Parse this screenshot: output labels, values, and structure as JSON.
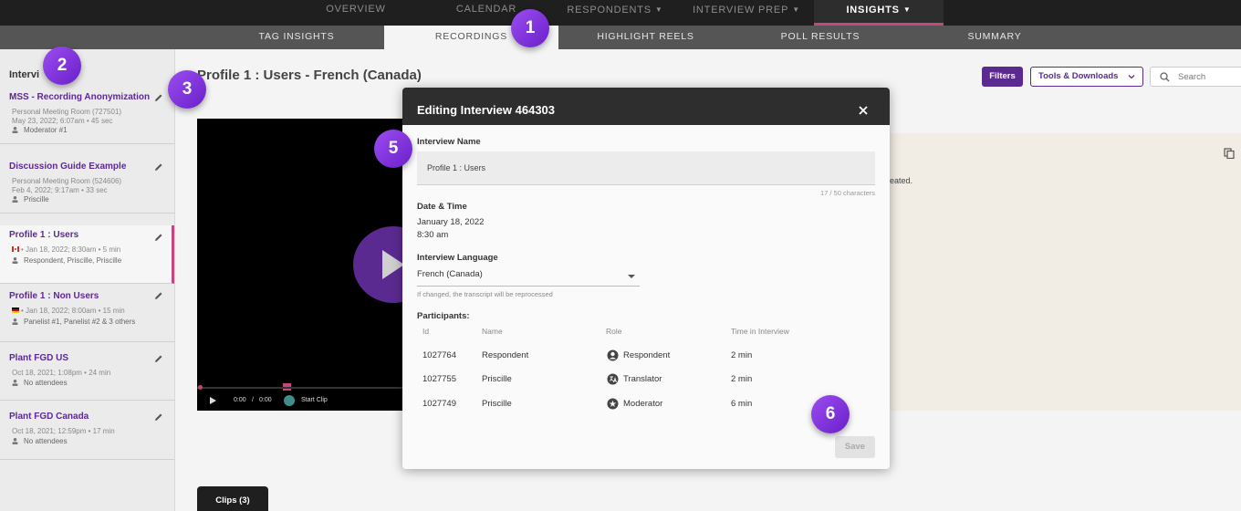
{
  "topnav": [
    {
      "label": "OVERVIEW",
      "dropdown": false
    },
    {
      "label": "CALENDAR",
      "dropdown": false
    },
    {
      "label": "RESPONDENTS",
      "dropdown": true
    },
    {
      "label": "INTERVIEW PREP",
      "dropdown": true
    },
    {
      "label": "INSIGHTS",
      "dropdown": true
    }
  ],
  "subnav": [
    "TAG INSIGHTS",
    "RECORDINGS",
    "HIGHLIGHT REELS",
    "POLL RESULTS",
    "SUMMARY"
  ],
  "sidebar": {
    "title": "Intervi",
    "items": [
      {
        "name": "MSS - Recording Anonymization",
        "line1": "Personal Meeting Room (727501)",
        "line2": "May 23, 2022; 6:07am • 45 sec",
        "line3": "Moderator #1"
      },
      {
        "name": "Discussion Guide Example",
        "line1": "Personal Meeting Room (524606)",
        "line2": "Feb 4, 2022; 9:17am • 33 sec",
        "line3": "Priscille"
      },
      {
        "name": "Profile 1 : Users",
        "line1": "• Jan 18, 2022; 8:30am • 5 min",
        "line2": "Respondent, Priscille, Priscille"
      },
      {
        "name": "Profile 1 : Non Users",
        "line1": "• Jan 18, 2022; 8:00am • 15 min",
        "line2": "Panelist #1, Panelist #2 & 3 others"
      },
      {
        "name": "Plant FGD US",
        "line1": "Oct 18, 2021; 1:08pm • 24 min",
        "line2": "No attendees"
      },
      {
        "name": "Plant FGD Canada",
        "line1": "Oct 18, 2021; 12:59pm • 17 min",
        "line2": "No attendees"
      }
    ]
  },
  "main": {
    "title": "Profile 1 : Users - French (Canada)",
    "filters_label": "Filters",
    "tools_label": "Tools & Downloads",
    "search_placeholder": "Search",
    "video": {
      "current_time": "0:00",
      "separator": "/",
      "duration": "0:00",
      "start_clip_label": "Start Clip"
    },
    "panel_text": "eated.",
    "clips_tab": "Clips (3)"
  },
  "modal": {
    "title": "Editing Interview 464303",
    "name_label": "Interview Name",
    "name_value": "Profile 1 : Users",
    "char_count": "17 / 50 characters",
    "datetime_label": "Date & Time",
    "date": "January 18, 2022",
    "time": "8:30 am",
    "language_label": "Interview Language",
    "language_value": "French (Canada)",
    "language_helper": "If changed, the transcript will be reprocessed",
    "participants_label": "Participants:",
    "columns": [
      "Id",
      "Name",
      "Role",
      "Time in Interview"
    ],
    "participants": [
      {
        "id": "1027764",
        "name": "Respondent",
        "role": "Respondent",
        "role_icon": "person-circle-icon",
        "time": "2 min"
      },
      {
        "id": "1027755",
        "name": "Priscille",
        "role": "Translator",
        "role_icon": "translate-icon",
        "time": "2 min"
      },
      {
        "id": "1027749",
        "name": "Priscille",
        "role": "Moderator",
        "role_icon": "star-circle-icon",
        "time": "6 min"
      }
    ],
    "save_label": "Save"
  },
  "callouts": [
    "1",
    "2",
    "3",
    "5",
    "6"
  ],
  "colors": {
    "accent_purple": "#5b2a91",
    "active_underline": "#c2477c",
    "callout": "#8a3ee6"
  }
}
